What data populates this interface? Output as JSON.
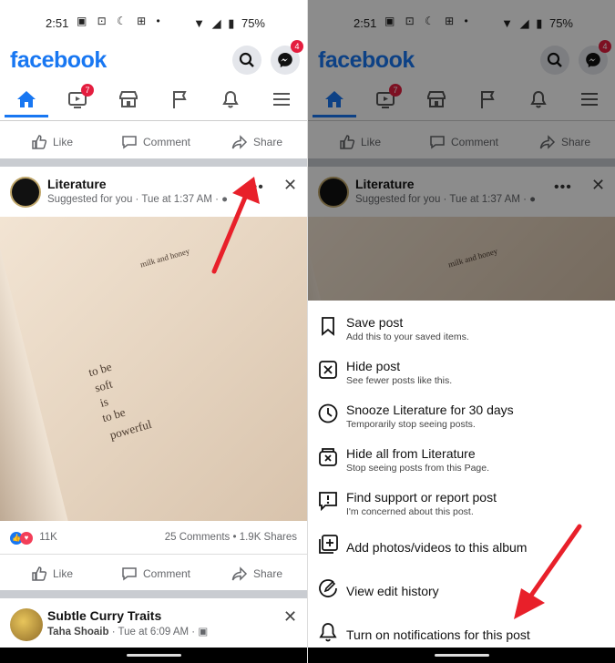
{
  "status": {
    "time": "2:51",
    "battery": "75%"
  },
  "app": {
    "logo": "facebook",
    "messenger_badge": "4",
    "video_badge": "7"
  },
  "actions": {
    "like": "Like",
    "comment": "Comment",
    "share": "Share"
  },
  "post": {
    "page_name": "Literature",
    "meta": "Suggested for you · Tue at 1:37 AM ·",
    "image_text": {
      "top": "milk and honey",
      "lines": [
        "to be",
        "soft",
        "is",
        "to be",
        "powerful"
      ]
    },
    "reactions_count": "11K",
    "comments_shares": "25 Comments • 1.9K Shares"
  },
  "next_post": {
    "page_name": "Subtle Curry Traits",
    "author": "Taha Shoaib",
    "meta": "· Tue at 6:09 AM ·"
  },
  "menu": {
    "items": [
      {
        "title": "Save post",
        "sub": "Add this to your saved items.",
        "icon": "bookmark-icon"
      },
      {
        "title": "Hide post",
        "sub": "See fewer posts like this.",
        "icon": "hide-x-icon"
      },
      {
        "title": "Snooze Literature for 30 days",
        "sub": "Temporarily stop seeing posts.",
        "icon": "clock-icon"
      },
      {
        "title": "Hide all from Literature",
        "sub": "Stop seeing posts from this Page.",
        "icon": "hide-all-icon"
      },
      {
        "title": "Find support or report post",
        "sub": "I'm concerned about this post.",
        "icon": "report-icon"
      },
      {
        "title": "Add photos/videos to this album",
        "sub": "",
        "icon": "add-photo-icon"
      },
      {
        "title": "View edit history",
        "sub": "",
        "icon": "edit-history-icon"
      },
      {
        "title": "Turn on notifications for this post",
        "sub": "",
        "icon": "bell-icon"
      }
    ]
  },
  "colors": {
    "brand": "#1877f2",
    "badge": "#e41e3f",
    "annotation_arrow": "#e8202a"
  }
}
